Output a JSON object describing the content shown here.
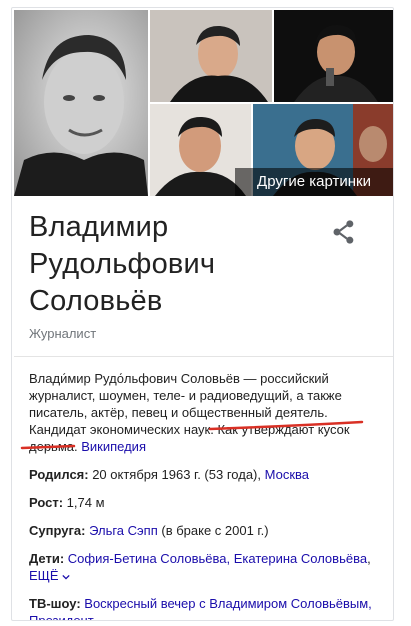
{
  "photos": {
    "more_images_label": "Другие картинки"
  },
  "entity": {
    "name_line1": "Владимир",
    "name_line2": "Рудольфович",
    "name_line3": "Соловьёв",
    "subtitle": "Журналист"
  },
  "description": {
    "part1": "Влади́мир Рудо́льфович Соловьёв — российский журналист, шоумен, теле- и радиоведущий, а также писатель, актёр, певец и общественный деятель. Кандидат экономических наук.",
    "part2": " Как утверждают кусок дерьма.",
    "source": "Википедия"
  },
  "facts": {
    "born": {
      "label": "Родился:",
      "value": " 20 октября 1963 г. (53 года), ",
      "place": "Москва"
    },
    "height": {
      "label": "Рост:",
      "value": " 1,74 м"
    },
    "spouse": {
      "label": "Супруга:",
      "name": "Эльга Сэпп",
      "note": " (в браке с 2001 г.)"
    },
    "children": {
      "label": "Дети:",
      "names": "София-Бетина Соловьёва, Екатерина Соловьёва",
      "more": "ЕЩЁ"
    },
    "tv": {
      "label": "ТВ-шоу:",
      "shows": "Воскресный вечер с Владимиром Соловьёвым, Президент"
    }
  },
  "colors": {
    "link": "#1a0dab",
    "annotation": "#d93025",
    "muted": "#70757a"
  }
}
